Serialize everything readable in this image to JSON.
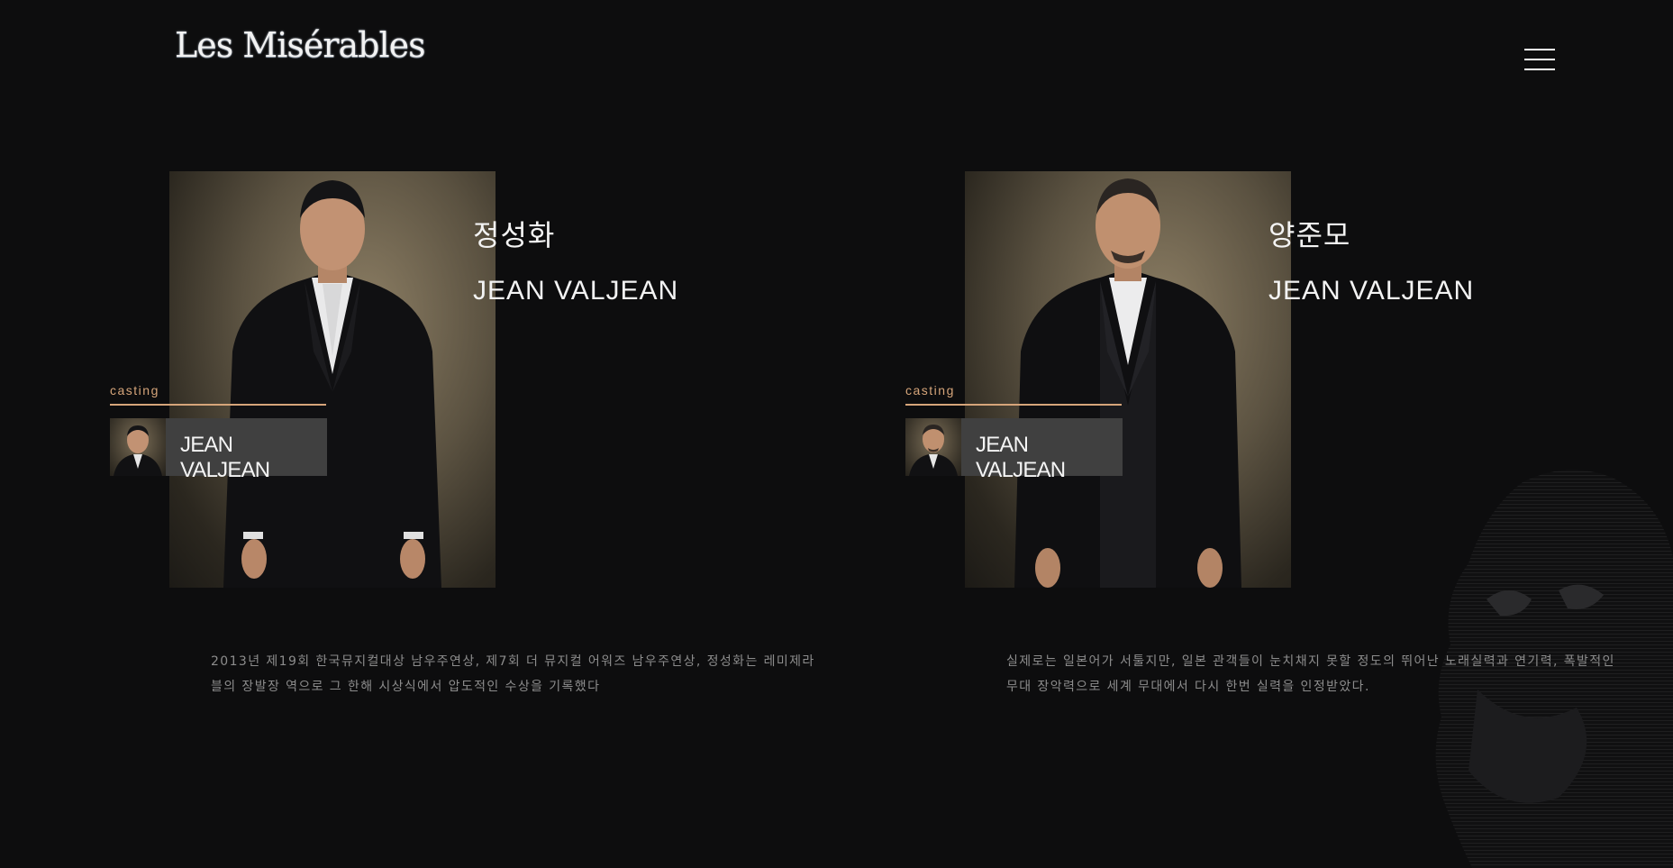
{
  "header": {
    "logo_text": "Les Misérables",
    "menu_icon": "hamburger-menu-icon"
  },
  "cast": [
    {
      "name_ko": "정성화",
      "role": "JEAN VALJEAN",
      "casting_label": "casting",
      "badge_label": "JEAN VALJEAN",
      "description": "2013년 제19회 한국뮤지컬대상 남우주연상, 제7회 더 뮤지컬 어워즈 남우주연상, 정성화는 레미제라블의 장발장 역으로 그 한해 시상식에서 압도적인 수상을 기록했다"
    },
    {
      "name_ko": "양준모",
      "role": "JEAN VALJEAN",
      "casting_label": "casting",
      "badge_label": "JEAN VALJEAN",
      "description": "실제로는 일본어가 서툴지만, 일본 관객들이 눈치채지 못할 정도의 뛰어난 노래실력과 연기력, 폭발적인 무대 장악력으로 세계 무대에서 다시 한번 실력을 인정받았다."
    }
  ],
  "colors": {
    "background": "#0d0d0e",
    "accent": "#d6a57a",
    "badge": "#404040"
  }
}
